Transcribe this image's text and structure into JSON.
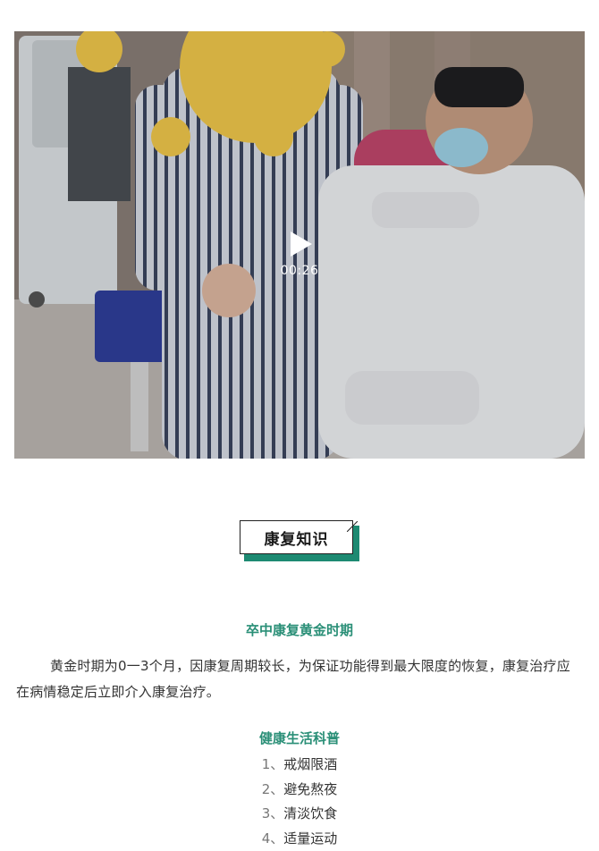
{
  "video": {
    "duration": "00:26",
    "play_icon": "play-icon"
  },
  "section_banner": {
    "label": "康复知识",
    "shadow_color": "#1d8a72"
  },
  "article": {
    "heading_1": "卒中康复黄金时期",
    "paragraph": "黄金时期为0一3个月，因康复周期较长，为保证功能得到最大限度的恢复，康复治疗应在病情稳定后立即介入康复治疗。",
    "heading_2": "健康生活科普",
    "tips": [
      {
        "num": "1、",
        "text": "戒烟限酒"
      },
      {
        "num": "2、",
        "text": "避免熬夜"
      },
      {
        "num": "3、",
        "text": "清淡饮食"
      },
      {
        "num": "4、",
        "text": "适量运动"
      }
    ],
    "accent_color": "#2a8f77"
  }
}
